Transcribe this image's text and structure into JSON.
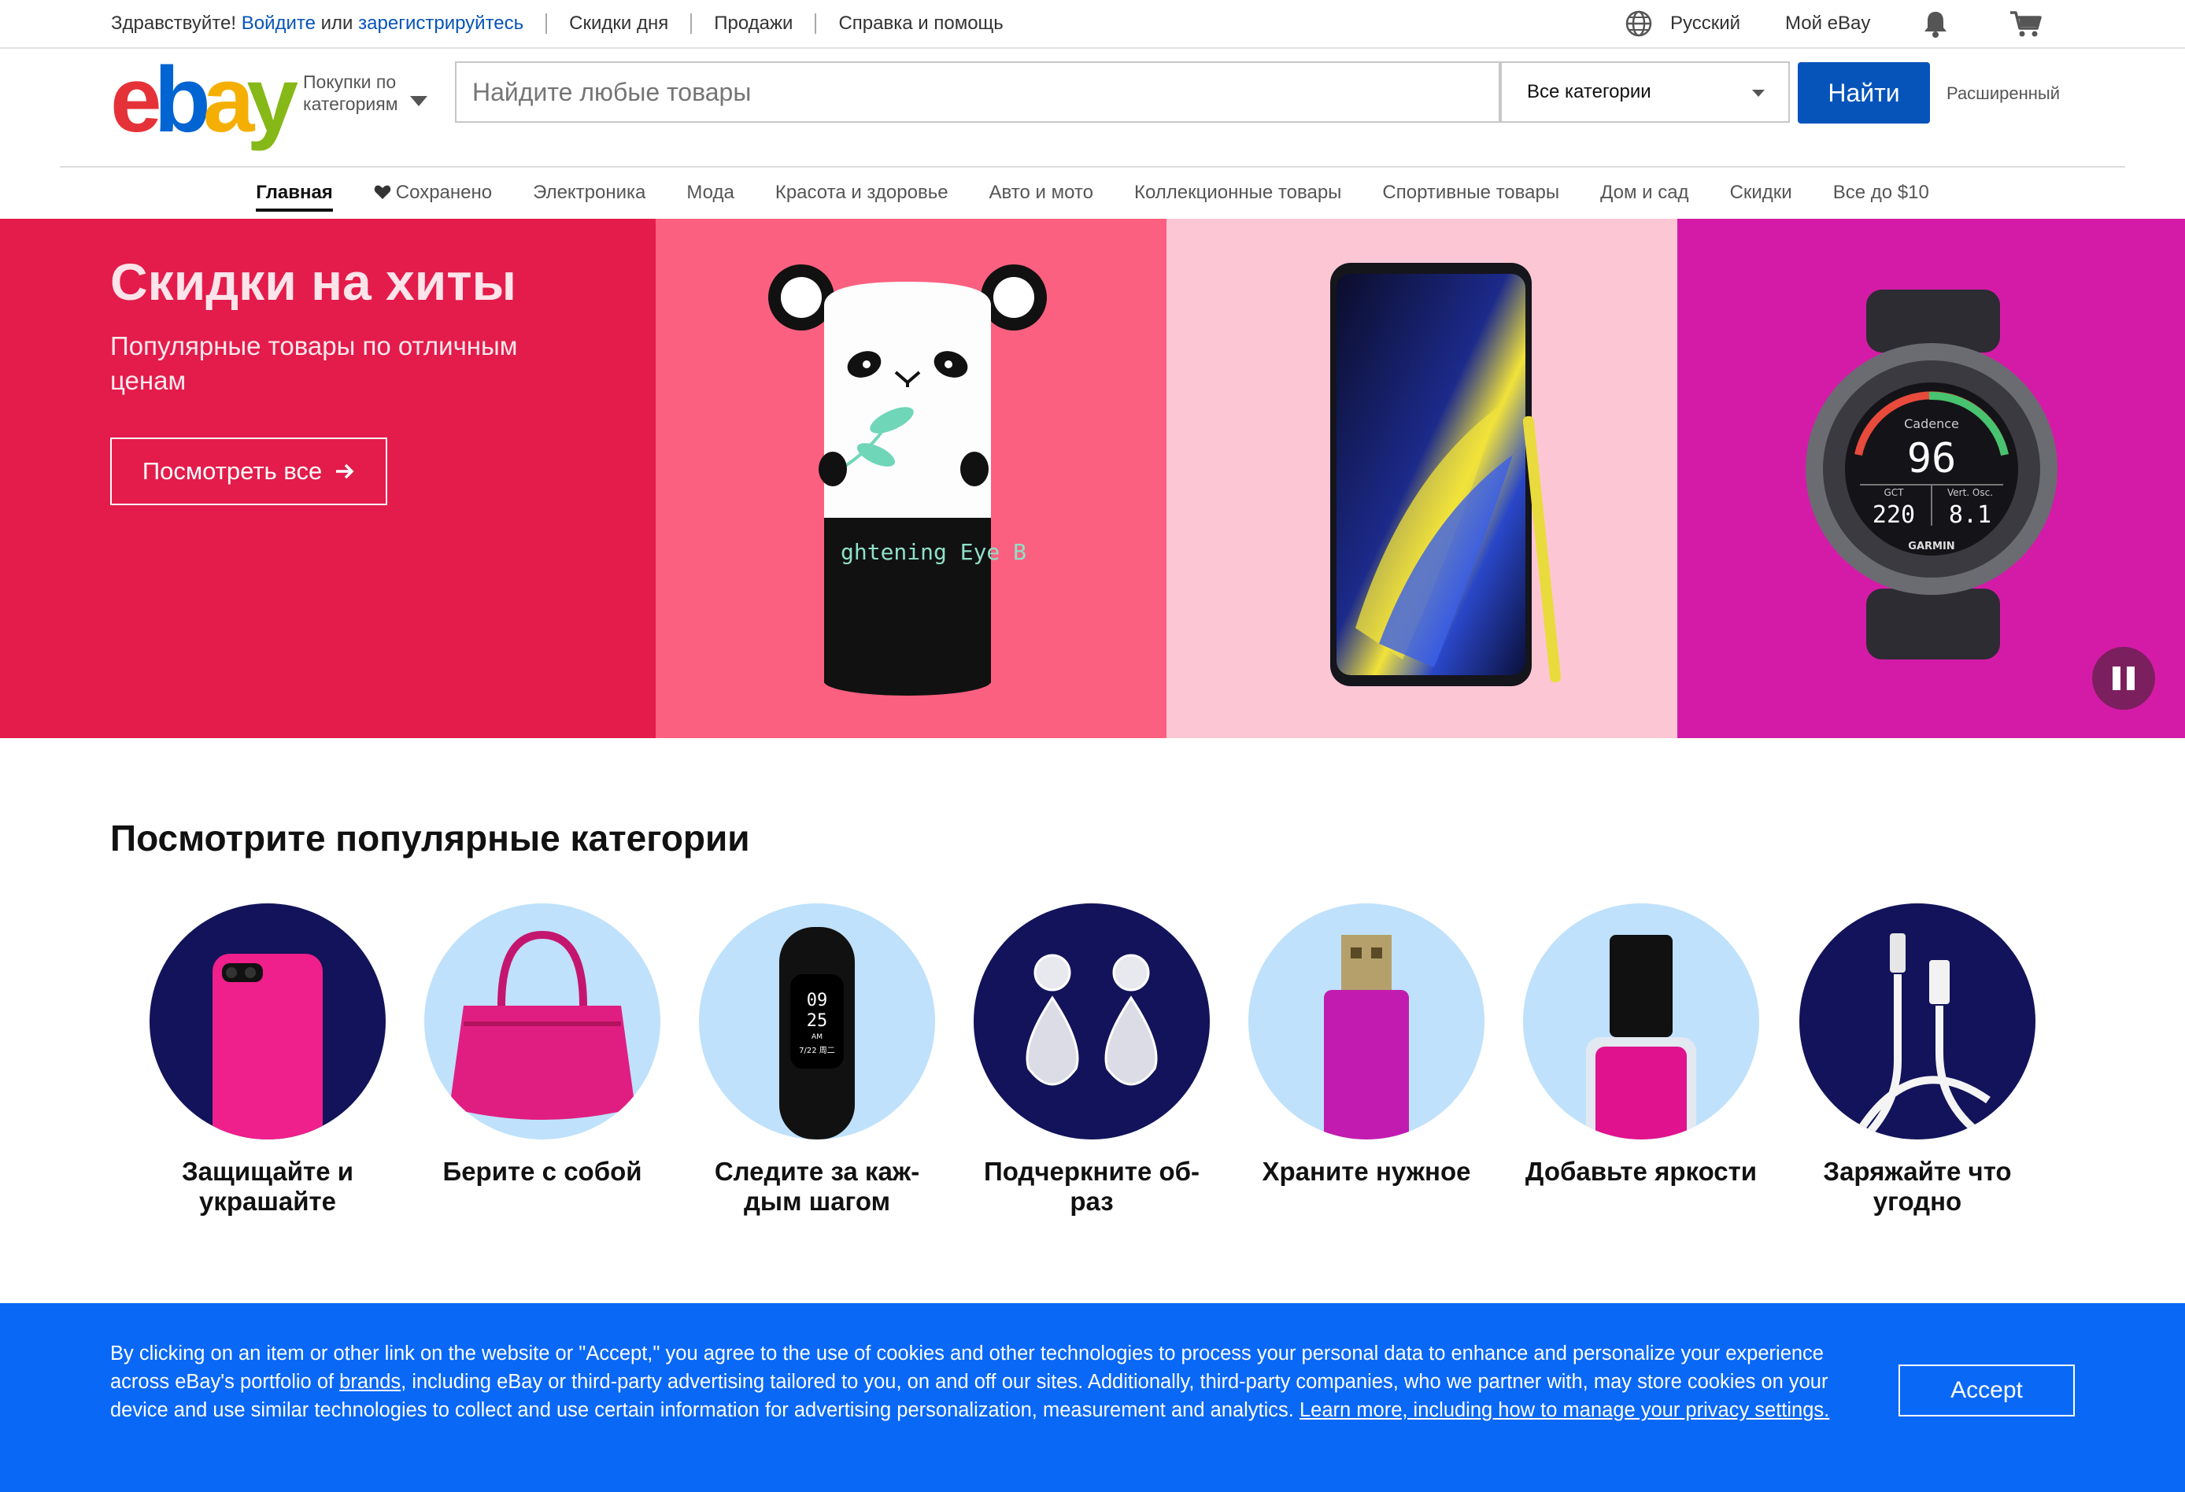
{
  "topbar": {
    "greeting": "Здравствуйте!",
    "signin": "Войдите",
    "or": "или",
    "register": "зарегистрируйтесь",
    "links": [
      "Скидки дня",
      "Продажи",
      "Справка и помощь"
    ],
    "language": "Русский",
    "my_ebay": "Мой eBay",
    "icons": [
      "globe-icon",
      "bell-icon",
      "cart-icon"
    ]
  },
  "header": {
    "logo": [
      "e",
      "b",
      "a",
      "y"
    ],
    "logo_colors": [
      "#e53238",
      "#0064d2",
      "#f5af02",
      "#86b817"
    ],
    "shop_by_line1": "Покупки по",
    "shop_by_line2": "категориям",
    "search_placeholder": "Найдите любые товары",
    "category_selected": "Все категории",
    "search_button": "Найти",
    "advanced": "Расширенный"
  },
  "nav": {
    "items": [
      "Главная",
      "Сохранено",
      "Электроника",
      "Мода",
      "Красота и здоровье",
      "Авто и мото",
      "Коллекционные товары",
      "Спортивные товары",
      "Дом и сад",
      "Скидки",
      "Все до $10"
    ]
  },
  "hero": {
    "title": "Скидки на хиты",
    "subtitle": "Популярные товары по отличным ценам",
    "button": "Посмотреть все",
    "panel_colors": [
      "#e31c4b",
      "#fc6080",
      "#fdc6d5",
      "#d41ba8"
    ],
    "product_label": "ghtening Eye B",
    "watch_texts": [
      "Cadence",
      "96",
      "GCT",
      "220",
      "Vert. Osc.",
      "8.1",
      "GARMIN"
    ]
  },
  "categories": {
    "title": "Посмотрите популярные категории",
    "items": [
      {
        "label": "Защищайте и украшайте",
        "bg": "#12135a"
      },
      {
        "label": "Берите с собой",
        "bg": "#bfe1fb"
      },
      {
        "label": "Следите за каж-дым шагом",
        "bg": "#bfe1fb",
        "screen": [
          "09",
          "25",
          "AM",
          "7/22 周二"
        ]
      },
      {
        "label": "Подчеркните об-раз",
        "bg": "#12135a"
      },
      {
        "label": "Храните нужное",
        "bg": "#bfe1fb"
      },
      {
        "label": "Добавьте яркости",
        "bg": "#bfe1fb"
      },
      {
        "label": "Заряжайте что угодно",
        "bg": "#12135a"
      }
    ]
  },
  "cookie": {
    "text_1": "By clicking on an item or other link on the website or \"Accept,\" you agree to the use of cookies and other technologies to process your personal data to enhance and personalize your experience across eBay's portfolio of ",
    "brands_link": "brands",
    "text_2": ", including eBay or third-party advertising tailored to you, on and off our sites. Additionally, third-party companies, who we partner with, may store cookies on your device and use similar technologies to collect and use certain information for advertising personalization, measurement and analytics. ",
    "learn_more": "Learn more, including how to manage your privacy settings.",
    "accept": "Accept",
    "bg": "#0968f6"
  }
}
